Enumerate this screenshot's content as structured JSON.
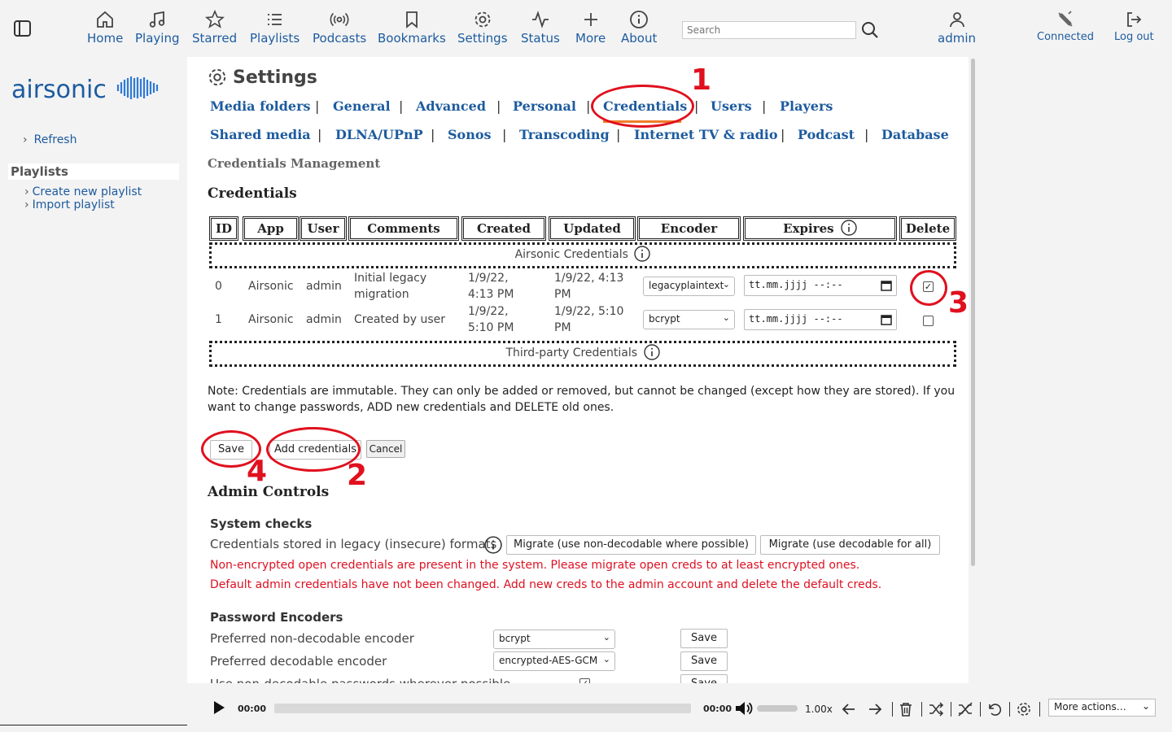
{
  "nav": {
    "home": "Home",
    "playing": "Playing",
    "starred": "Starred",
    "playlists": "Playlists",
    "podcasts": "Podcasts",
    "bookmarks": "Bookmarks",
    "settings": "Settings",
    "status": "Status",
    "more": "More",
    "about": "About",
    "search_placeholder": "Search",
    "user": "admin",
    "connected": "Connected",
    "logout": "Log out"
  },
  "sidebar": {
    "logo_text": "airsonic",
    "refresh": "Refresh",
    "playlists_heading": "Playlists",
    "create_playlist": "Create new playlist",
    "import_playlist": "Import playlist"
  },
  "settings": {
    "title": "Settings",
    "tabs_row1": [
      "Media folders",
      "General",
      "Advanced",
      "Personal",
      "Credentials",
      "Users",
      "Players"
    ],
    "tabs_row2": [
      "Shared media",
      "DLNA/UPnP",
      "Sonos",
      "Transcoding",
      "Internet TV & radio",
      "Podcast",
      "Database"
    ],
    "active_tab": "Credentials",
    "section": "Credentials Management"
  },
  "credentials": {
    "heading": "Credentials",
    "columns": [
      "ID",
      "App",
      "User",
      "Comments",
      "Created",
      "Updated",
      "Encoder",
      "Expires",
      "Delete"
    ],
    "group_airsonic": "Airsonic Credentials",
    "group_thirdparty": "Third-party Credentials",
    "rows": [
      {
        "id": "0",
        "app": "Airsonic",
        "user": "admin",
        "comments": "Initial legacy migration",
        "created": "1/9/22, 4:13 PM",
        "updated": "1/9/22, 4:13 PM",
        "encoder": "legacyplaintext",
        "expires": "tt.mm.jjjj --:--",
        "delete": true
      },
      {
        "id": "1",
        "app": "Airsonic",
        "user": "admin",
        "comments": "Created by user",
        "created": "1/9/22, 5:10 PM",
        "updated": "1/9/22, 5:10 PM",
        "encoder": "bcrypt",
        "expires": "tt.mm.jjjj --:--",
        "delete": false
      }
    ],
    "note": "Note: Credentials are immutable. They can only be added or removed, but cannot be changed (except how they are stored). If you want to change passwords, ADD new credentials and DELETE old ones.",
    "save": "Save",
    "add": "Add credentials",
    "cancel": "Cancel"
  },
  "admin": {
    "heading": "Admin Controls",
    "system_checks": "System checks",
    "legacy_label": "Credentials stored in legacy (insecure) formats",
    "migrate_nondecodable": "Migrate (use non-decodable where possible)",
    "migrate_decodable": "Migrate (use decodable for all)",
    "error1": "Non-encrypted open credentials are present in the system. Please migrate open creds to at least encrypted ones.",
    "error2": "Default admin credentials have not been changed. Add new creds to the admin account and delete the default creds.",
    "encoders_heading": "Password Encoders",
    "nondecodable_label": "Preferred non-decodable encoder",
    "nondecodable_value": "bcrypt",
    "decodable_label": "Preferred decodable encoder",
    "decodable_value": "encrypted-AES-GCM",
    "nondecodable_wherever_label": "Use non-decodable passwords wherever possible",
    "save": "Save"
  },
  "annotations": [
    "1",
    "2",
    "3",
    "4"
  ],
  "player": {
    "time_current": "00:00",
    "time_total": "00:00",
    "speed": "1.00x",
    "more_actions": "More actions…"
  },
  "colors": {
    "link": "#1d5b9e",
    "annotation": "#e0101e",
    "error": "#dd1122",
    "active_tab_underline": "#f07c2a"
  }
}
